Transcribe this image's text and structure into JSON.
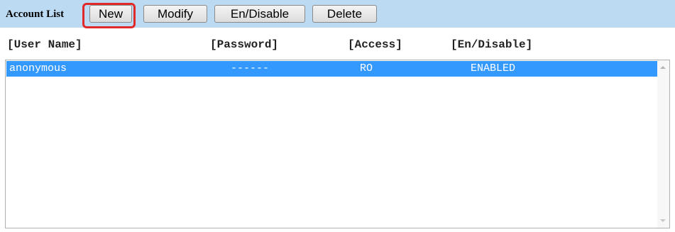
{
  "toolbar": {
    "title": "Account List",
    "buttons": {
      "new": "New",
      "modify": "Modify",
      "endisable": "En/Disable",
      "delete": "Delete"
    },
    "highlighted_button": "New",
    "highlight_color": "#e02a2a",
    "background_color": "#bcdaf1"
  },
  "table": {
    "headers": [
      "[User Name]",
      "[Password]",
      "[Access]",
      "[En/Disable]"
    ],
    "rows": [
      {
        "user_name": "anonymous",
        "password": "------",
        "access": "RO",
        "status": "ENABLED",
        "selected": true
      }
    ],
    "selection_color": "#3399ff"
  },
  "icons": {
    "scroll_up": "chevron-up-icon",
    "scroll_down": "chevron-down-icon"
  }
}
